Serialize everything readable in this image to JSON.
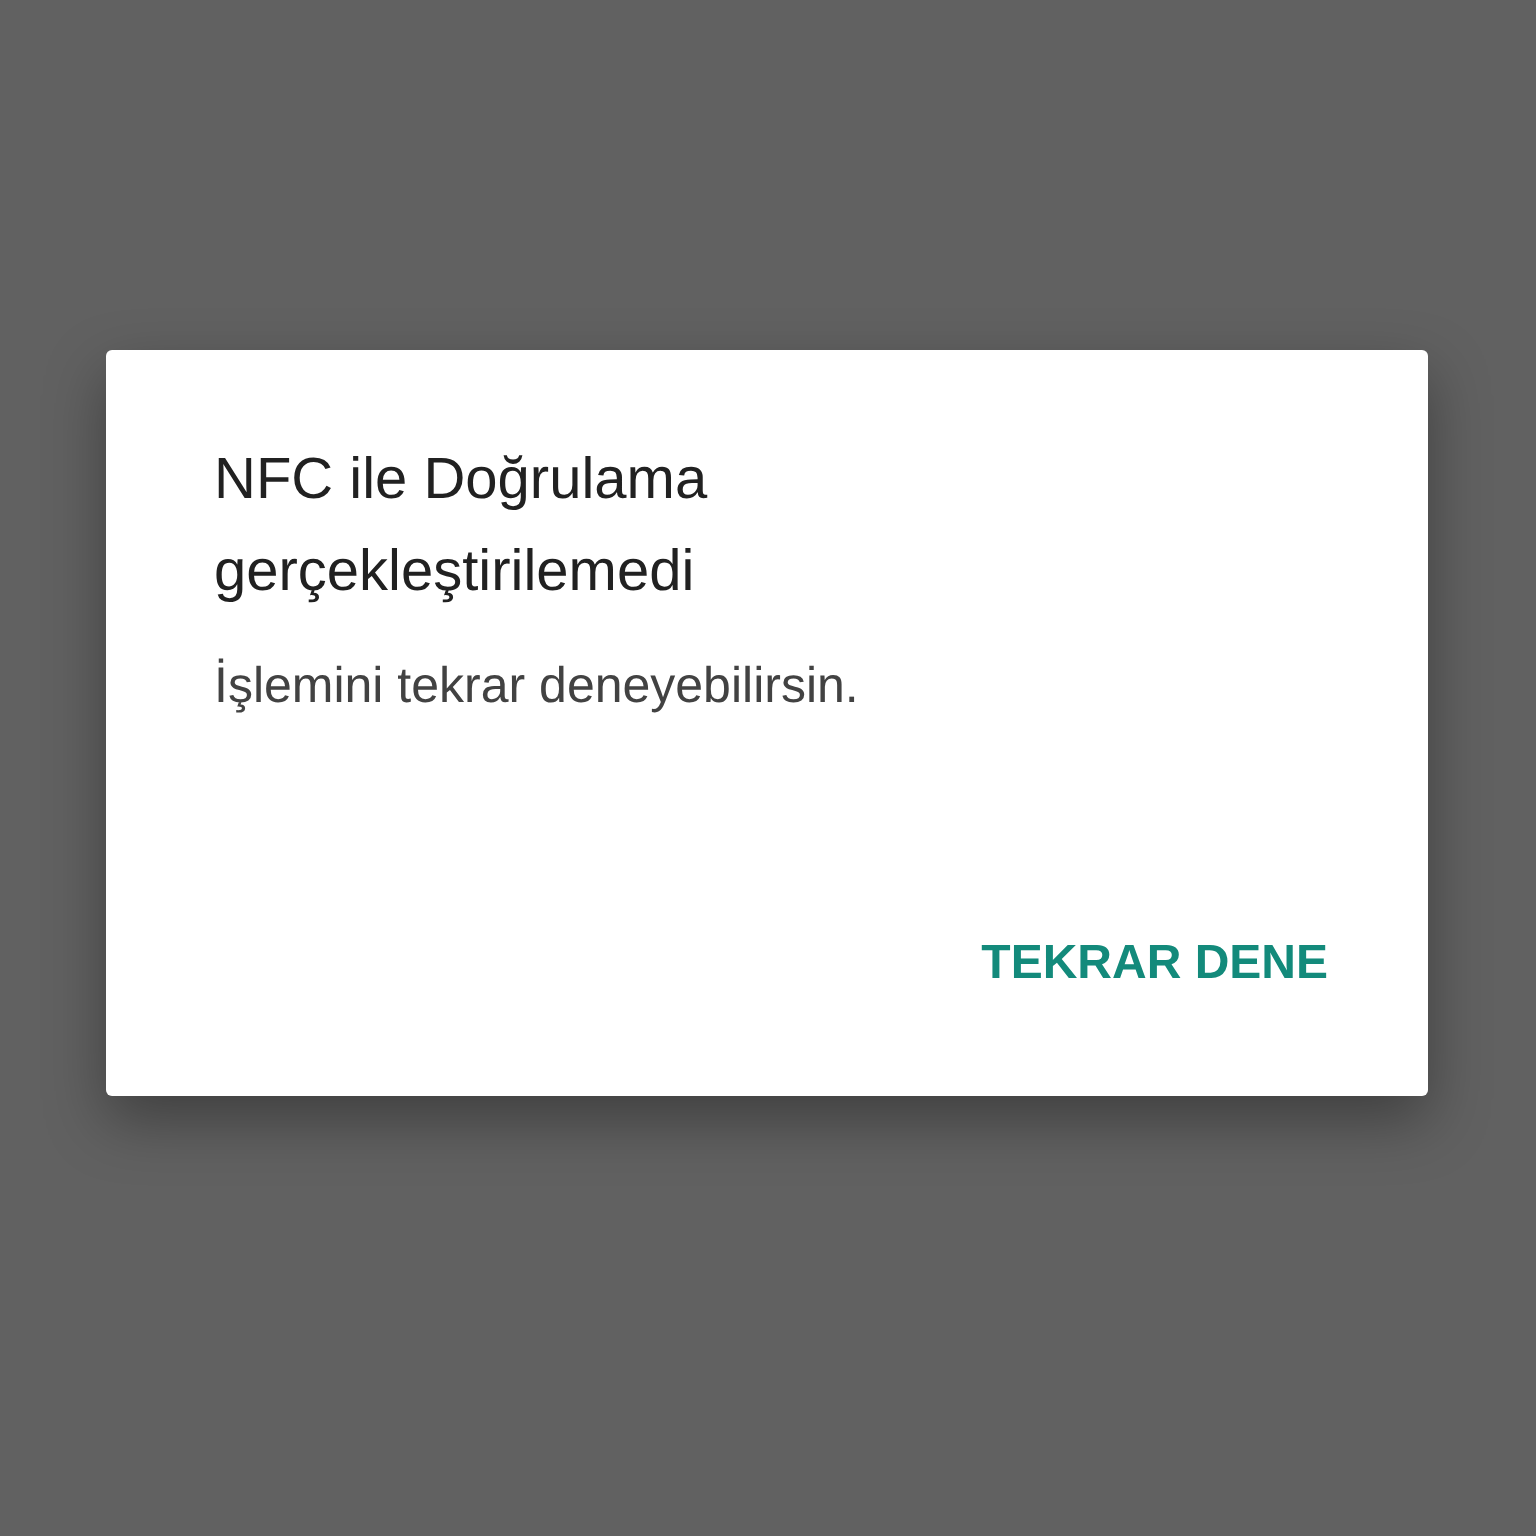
{
  "dialog": {
    "title": "NFC ile Doğrulama gerçekleştirilemedi",
    "message": "İşlemini tekrar deneyebilirsin.",
    "buttons": [
      {
        "label": "TEKRAR DENE"
      }
    ]
  }
}
